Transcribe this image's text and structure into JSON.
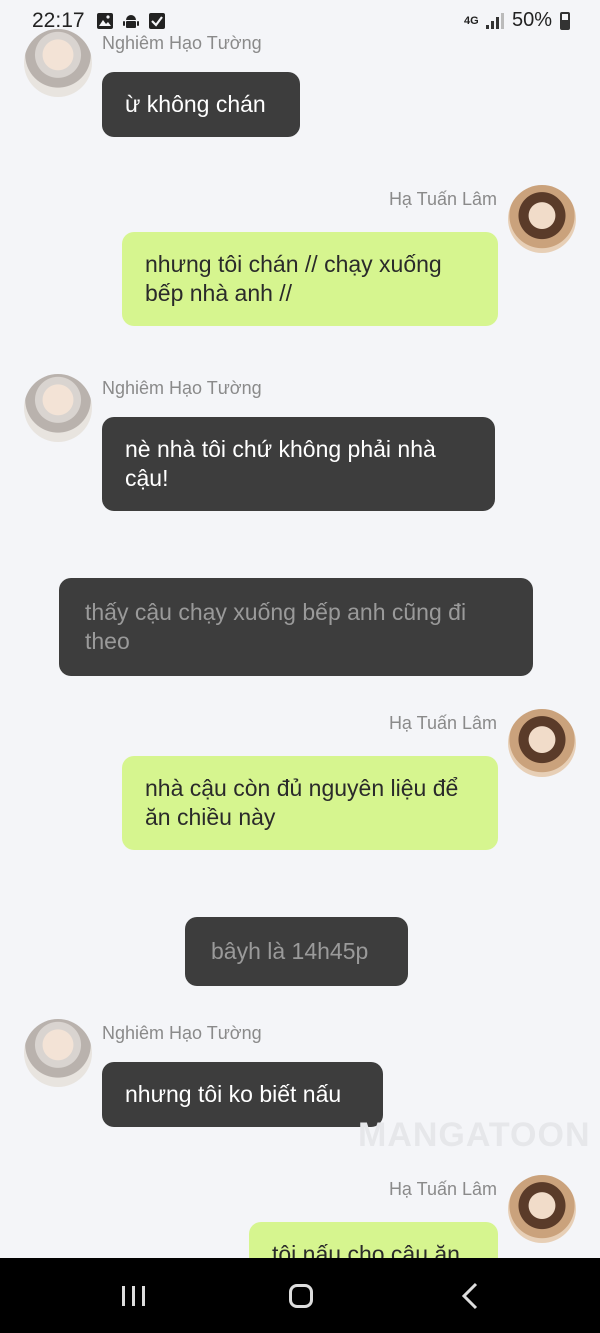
{
  "status_bar": {
    "time": "22:17",
    "network": "4G",
    "battery": "50%"
  },
  "chat": {
    "messages": [
      {
        "sender": "Nghiêm Hạo Tường",
        "text": "ừ không chán"
      },
      {
        "sender": "Hạ Tuấn Lâm",
        "text": "nhưng tôi chán // chạy xuống bếp nhà anh //"
      },
      {
        "sender": "Nghiêm Hạo Tường",
        "text": "nè nhà tôi chứ không phải nhà cậu!"
      },
      {
        "narration": "thấy cậu chạy xuống bếp anh cũng đi theo"
      },
      {
        "sender": "Hạ Tuấn Lâm",
        "text": "nhà cậu còn đủ nguyên liệu để ăn chiều này"
      },
      {
        "narration": "bâyh là 14h45p"
      },
      {
        "sender": "Nghiêm Hạo Tường",
        "text": "nhưng tôi ko biết nấu"
      },
      {
        "sender": "Hạ Tuấn Lâm",
        "text": "tôi nấu cho cậu ăn"
      }
    ]
  },
  "watermark": "MANGATOON",
  "colors": {
    "background": "#f4f5f8",
    "left_bubble": "#3d3d3d",
    "right_bubble": "#d6f58f",
    "narration_text": "#9a9a9a"
  },
  "icons": [
    "image-icon",
    "android-icon",
    "checkbox-icon",
    "signal-icon",
    "battery-icon",
    "recent-apps-icon",
    "home-icon",
    "back-icon"
  ]
}
